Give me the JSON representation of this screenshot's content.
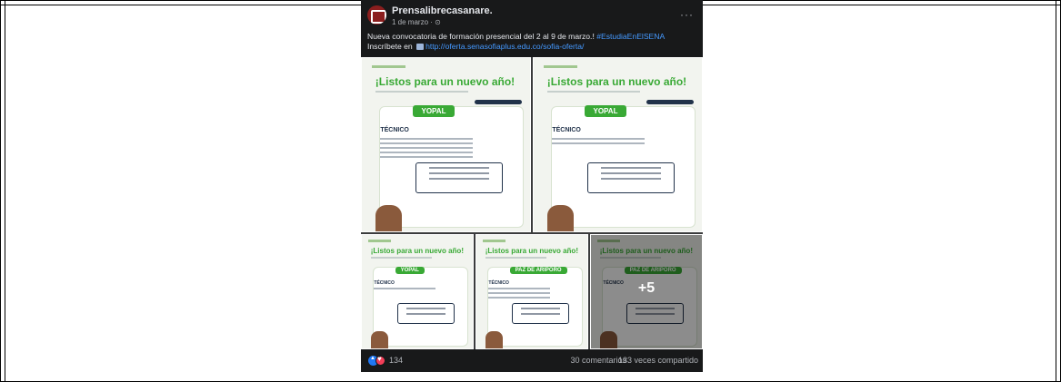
{
  "post": {
    "page_name": "Prensalibrecasanare.",
    "date": "1 de marzo · ⊙",
    "more": "···",
    "text_line1": "Nueva convocatoria de formación presencial del 2 al 9 de marzo.! ",
    "hashtag": "#EstudiaEnElSENA",
    "text_line2": "Inscríbete en ",
    "link": "http://oferta.senasofiaplus.edu.co/sofia-oferta/"
  },
  "media": {
    "tiles": [
      {
        "title": "¡Listos para un nuevo año!",
        "city": "YOPAL",
        "section": "TÉCNICO"
      },
      {
        "title": "¡Listos para un nuevo año!",
        "city": "YOPAL",
        "section": "TÉCNICO"
      },
      {
        "title": "¡Listos para un nuevo año!",
        "city": "YOPAL",
        "section": "TÉCNICO"
      },
      {
        "title": "¡Listos para un nuevo año!",
        "city": "PAZ DE ARIPORO",
        "section": "TÉCNICO"
      },
      {
        "title": "¡Listos para un nuevo año!",
        "city": "PAZ DE ARIPORO",
        "section": "TÉCNICO"
      }
    ],
    "more_count": "+5"
  },
  "reactions": {
    "count": "134",
    "comments": "30 comentarios",
    "shares": "133 veces compartido"
  },
  "colors": {
    "post_bg": "#18191a",
    "link": "#4599ff",
    "flyer_green": "#39a935",
    "like_blue": "#2078f4",
    "love_red": "#f33e58"
  },
  "icons": [
    "page-avatar-icon",
    "more-options-icon",
    "inline-pointer-icon",
    "like-reaction-icon",
    "love-reaction-icon"
  ]
}
